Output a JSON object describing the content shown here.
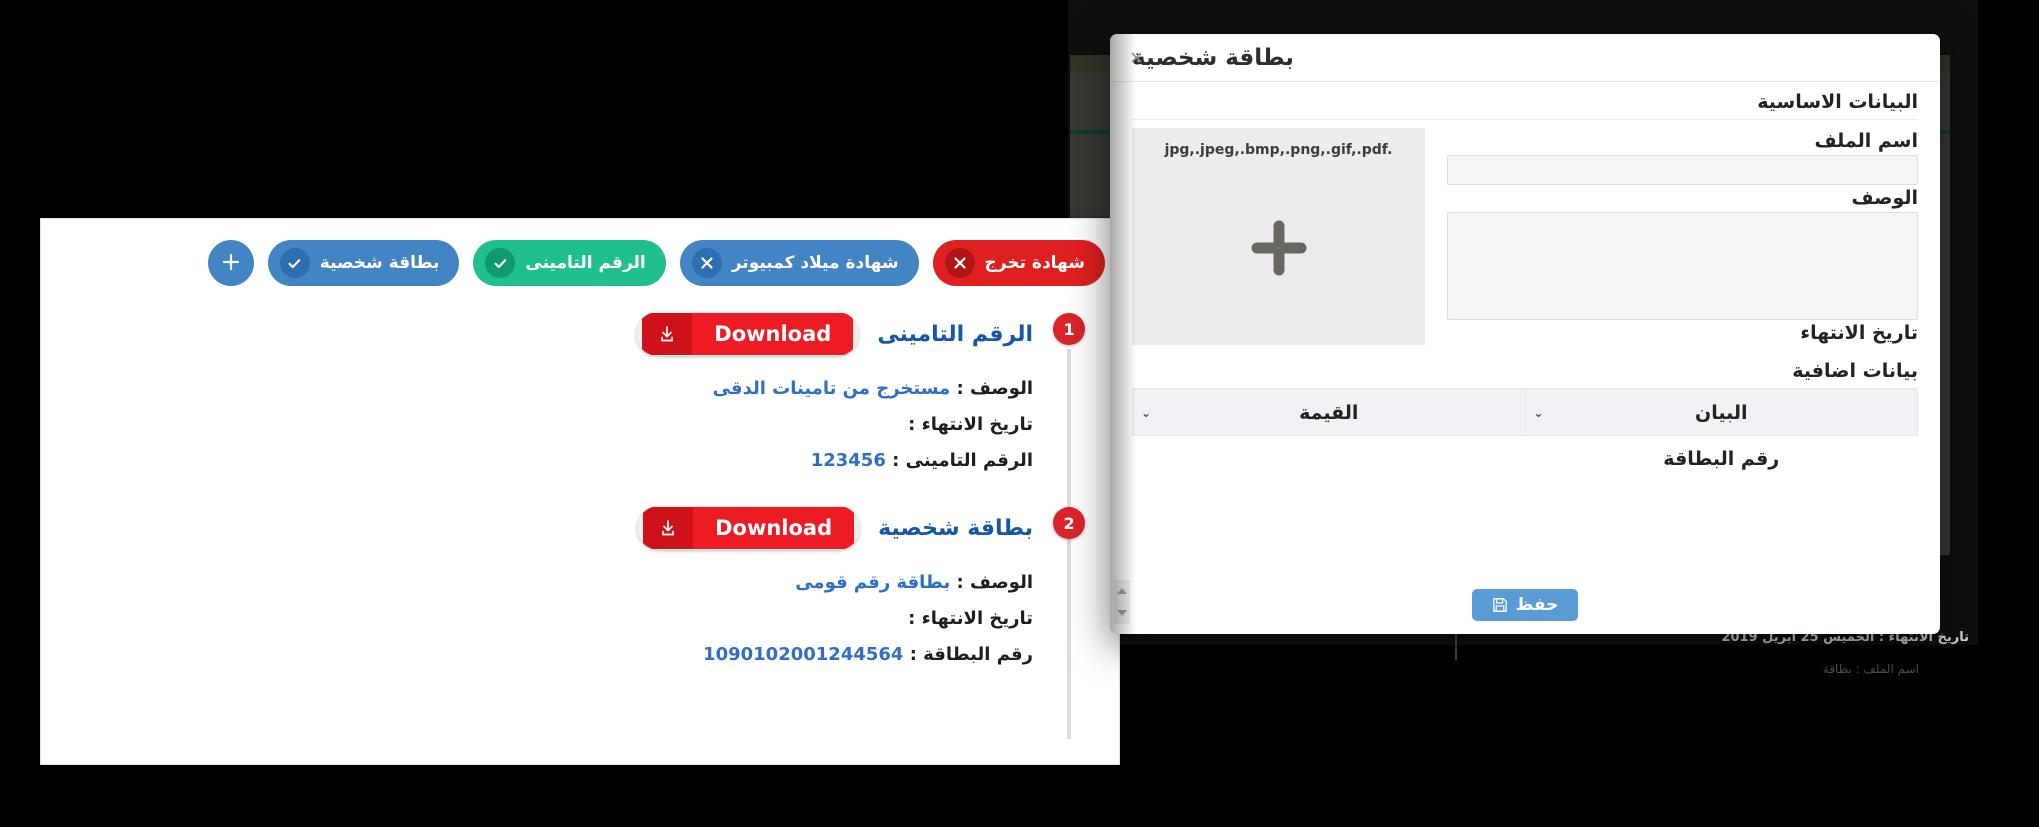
{
  "background": {
    "expiry_line": "تاريخ الانتهاء : الخميس 25 ابريل 2019",
    "faint_line": "اسم الملف : بطاقة"
  },
  "documents_panel": {
    "chips": [
      {
        "label": "شهادة تخرج",
        "icon": "close-icon",
        "color": "#e02020",
        "style": "red"
      },
      {
        "label": "شهادة ميلاد كمبيوتر",
        "icon": "close-icon",
        "color": "#4284c4",
        "style": "blue"
      },
      {
        "label": "الرقم التامينى",
        "icon": "check-icon",
        "color": "#20bf8f",
        "style": "green"
      },
      {
        "label": "بطاقة شخصية",
        "icon": "check-icon",
        "color": "#4284c4",
        "style": "blue"
      }
    ],
    "add_button": {
      "icon": "plus-icon",
      "label": "+"
    },
    "timeline": [
      {
        "badge": "1",
        "title": "الرقم التامينى",
        "download_label": "Download",
        "fields": [
          {
            "label": "الوصف :",
            "value": "مستخرج من تامينات الدقى"
          },
          {
            "label": "تاريخ الانتهاء :",
            "value": ""
          },
          {
            "label": "الرقم التامينى :",
            "value": "123456"
          }
        ]
      },
      {
        "badge": "2",
        "title": "بطاقة شخصية",
        "download_label": "Download",
        "fields": [
          {
            "label": "الوصف :",
            "value": "بطاقة رقم قومى"
          },
          {
            "label": "تاريخ الانتهاء :",
            "value": ""
          },
          {
            "label": "رقم البطاقة :",
            "value": "1090102001244564"
          }
        ]
      }
    ]
  },
  "modal": {
    "title": "بطاقة شخصية",
    "close_label": "×",
    "basic_section_title": "البيانات الاساسية",
    "file_name_label": "اسم الملف",
    "file_name_value": "",
    "file_name_placeholder": "",
    "description_label": "الوصف",
    "description_value": "",
    "description_placeholder": "",
    "expiry_label": "تاريخ الانتهاء",
    "upload_hint": "jpg,.jpeg,.bmp,.png,.gif,.pdf.",
    "upload_plus_icon": "plus-icon",
    "extra_section_title": "بيانات اضافية",
    "table": {
      "columns": [
        "البيان",
        "القيمة"
      ],
      "rows": [
        [
          "رقم البطاقة",
          ""
        ]
      ]
    },
    "save_label": "حفظ",
    "save_icon": "floppy-disk-icon"
  },
  "colors": {
    "chip_blue": "#4284c4",
    "chip_green": "#20bf8f",
    "chip_red": "#e02020",
    "download_red": "#ed1c24",
    "badge_red": "#d9252a",
    "link_blue": "#1757a8",
    "save_blue": "#5b9bd5"
  }
}
